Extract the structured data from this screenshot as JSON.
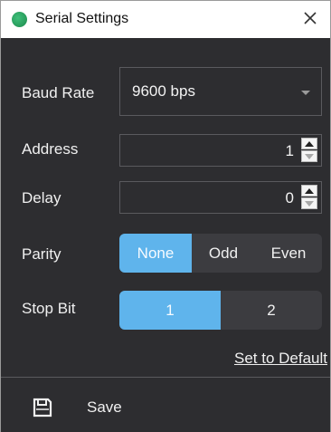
{
  "window": {
    "title": "Serial Settings"
  },
  "form": {
    "baud_label": "Baud Rate",
    "baud_value": "9600 bps",
    "address_label": "Address",
    "address_value": "1",
    "delay_label": "Delay",
    "delay_value": "0",
    "parity_label": "Parity",
    "parity_options": [
      "None",
      "Odd",
      "Even"
    ],
    "parity_selected": "None",
    "stopbit_label": "Stop Bit",
    "stopbit_options": [
      "1",
      "2"
    ],
    "stopbit_selected": "1",
    "default_link": "Set to Default"
  },
  "footer": {
    "save_label": "Save",
    "save_icon": "floppy-disk-icon"
  },
  "colors": {
    "accent": "#5fb4ec",
    "background": "#2d2d30",
    "title_icon": "#2ea862"
  }
}
